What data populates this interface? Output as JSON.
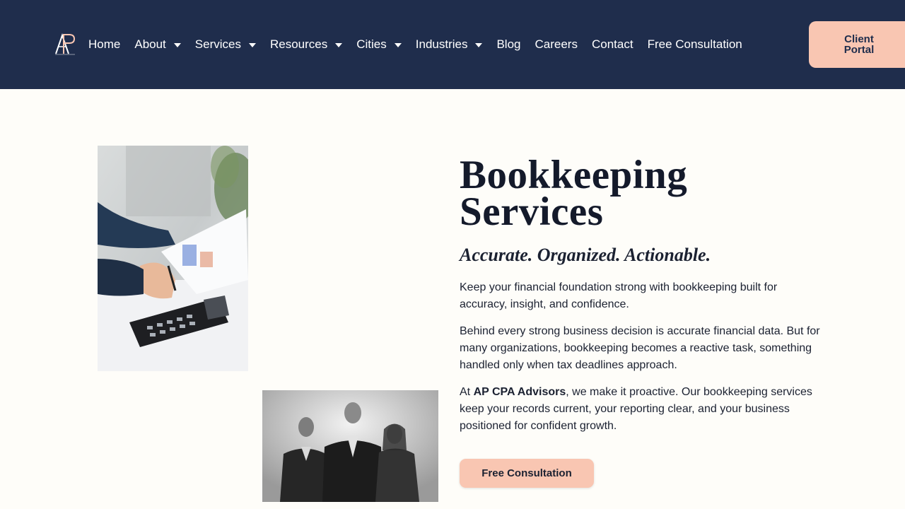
{
  "header": {
    "logo_text": "AP",
    "nav": [
      {
        "label": "Home",
        "has_dropdown": false
      },
      {
        "label": "About",
        "has_dropdown": true
      },
      {
        "label": "Services",
        "has_dropdown": true
      },
      {
        "label": "Resources",
        "has_dropdown": true
      },
      {
        "label": "Cities",
        "has_dropdown": true
      },
      {
        "label": "Industries",
        "has_dropdown": true
      },
      {
        "label": "Blog",
        "has_dropdown": false
      },
      {
        "label": "Careers",
        "has_dropdown": false
      },
      {
        "label": "Contact",
        "has_dropdown": false
      },
      {
        "label": "Free Consultation",
        "has_dropdown": false
      }
    ],
    "portal_line1": "Client",
    "portal_line2": "Portal"
  },
  "hero": {
    "title_line1": "Bookkeeping",
    "title_line2": "Services",
    "subtitle": "Accurate. Organized. Actionable.",
    "para1": "Keep your financial foundation strong with bookkeeping built for accuracy, insight, and confidence.",
    "para2": "Behind every strong business decision is accurate financial data. But for many organizations, bookkeeping becomes a reactive task, something handled only when tax deadlines approach.",
    "para3_prefix": "At ",
    "para3_brand": "AP CPA Advisors",
    "para3_suffix": ", we make it proactive. Our bookkeeping services keep your records current, your reporting clear, and your business positioned for confident growth.",
    "cta_label": "Free Consultation"
  },
  "colors": {
    "header_bg": "#1f2d4c",
    "accent": "#f9c6b2",
    "page_bg": "#fefdf9"
  }
}
